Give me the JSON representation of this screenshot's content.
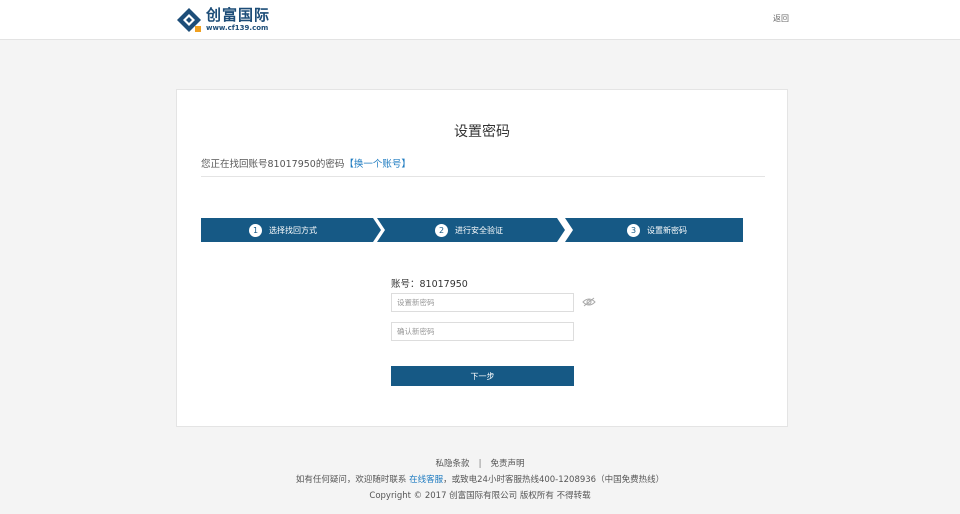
{
  "header": {
    "logo_name": "创富国际",
    "logo_url": "www.cf139.com",
    "back_label": "返回"
  },
  "card": {
    "title": "设置密码",
    "notice_prefix": "您正在找回账号81017950的密码",
    "switch_account_link": "【换一个账号】"
  },
  "steps": [
    {
      "number": "1",
      "label": "选择找回方式"
    },
    {
      "number": "2",
      "label": "进行安全验证"
    },
    {
      "number": "3",
      "label": "设置新密码"
    }
  ],
  "form": {
    "account_label": "账号：81017950",
    "new_password_placeholder": "设置新密码",
    "confirm_password_placeholder": "确认新密码",
    "next_button": "下一步"
  },
  "footer": {
    "privacy_link": "私隐条款",
    "separator": "|",
    "disclaimer_link": "免责声明",
    "contact_prefix": "如有任何疑问，欢迎随时联系",
    "online_service_link": "在线客服",
    "contact_suffix": "，或致电24小时客服热线400-1208936（中国免费热线）",
    "copyright": "Copyright © 2017 创富国际有限公司 版权所有 不得转载"
  },
  "colors": {
    "primary": "#165985",
    "link": "#1e7bc0",
    "background": "#f4f4f4"
  },
  "icons": {
    "logo": "diamond-logo-icon",
    "eye": "eye-toggle-icon"
  }
}
